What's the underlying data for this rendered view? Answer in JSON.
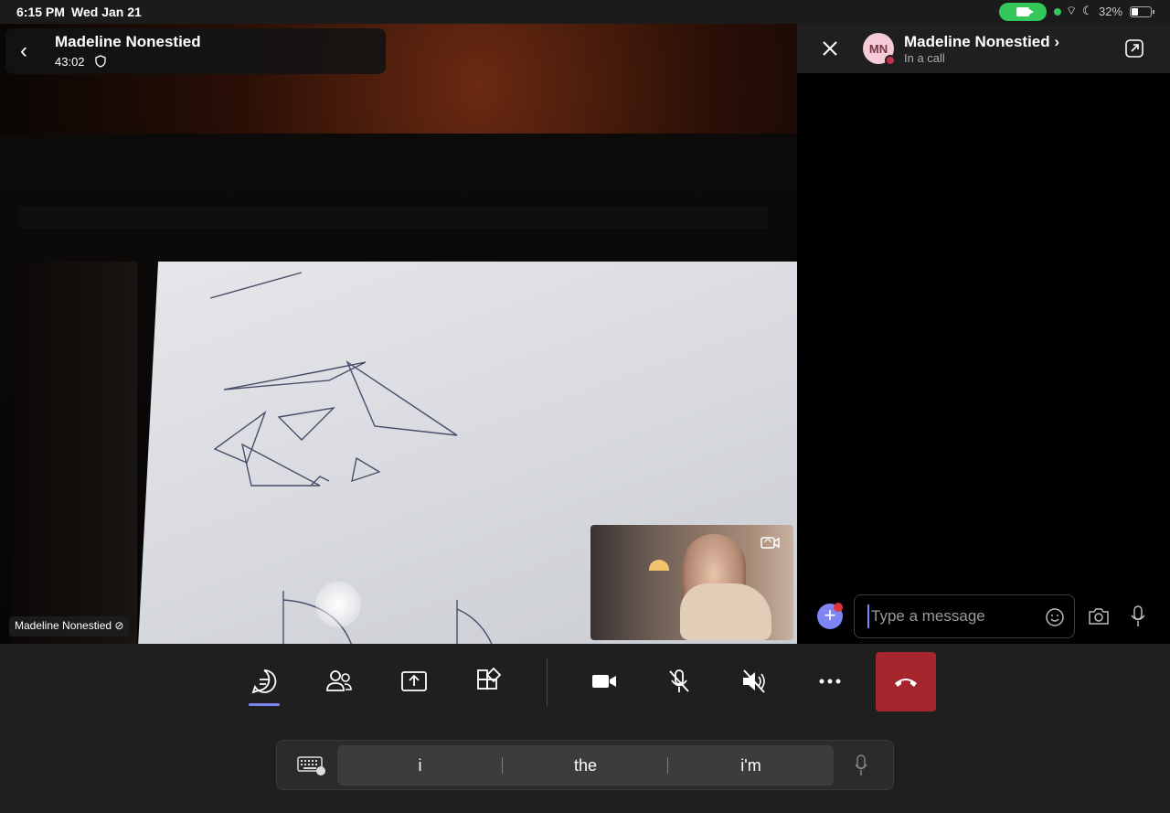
{
  "status_bar": {
    "time": "6:15 PM",
    "date": "Wed Jan 21",
    "battery": "32%"
  },
  "call": {
    "title": "Madeline Nonestied",
    "duration": "43:02",
    "participant_label": "Madeline Nonestied"
  },
  "chat": {
    "avatar_initials": "MN",
    "title": "Madeline Nonestied",
    "title_chevron": "›",
    "subtitle": "In a call",
    "input_placeholder": "Type a message"
  },
  "controls": {
    "items": [
      "chat-icon",
      "people-icon",
      "share-screen-icon",
      "apps-icon",
      "video-icon",
      "mic-muted-icon",
      "speaker-muted-icon",
      "more-icon",
      "hang-up-icon"
    ],
    "active": "chat-icon"
  },
  "keyboard": {
    "suggestions": [
      "i",
      "the",
      "i'm"
    ]
  },
  "colors": {
    "accent": "#7f85f5",
    "hangup": "#a4262c",
    "facetime_pill": "#34c759",
    "busy_status": "#c4314b"
  }
}
